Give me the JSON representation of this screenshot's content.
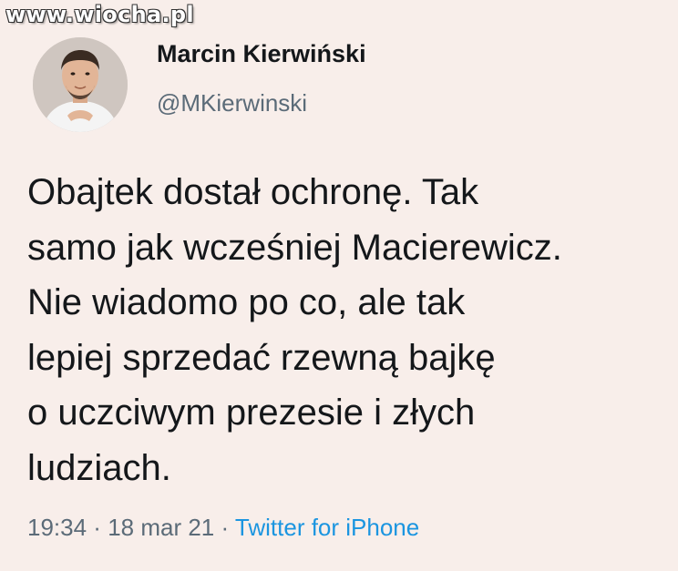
{
  "watermark": "www.wiocha.pl",
  "author": {
    "display_name": "Marcin Kierwiński",
    "handle": "@MKierwinski"
  },
  "tweet": {
    "lines": [
      "Obajtek dostał ochronę. Tak",
      "samo jak wcześniej Macierewicz.",
      "Nie wiadomo po co, ale tak",
      "lepiej sprzedać rzewną bajkę",
      "o uczciwym prezesie i złych",
      "ludziach."
    ]
  },
  "meta": {
    "time": "19:34",
    "separator": " · ",
    "date": "18 mar 21",
    "source": "Twitter for iPhone"
  },
  "colors": {
    "background": "#f8eeea",
    "link": "#1b95e0",
    "secondary_text": "#5b6b78"
  }
}
